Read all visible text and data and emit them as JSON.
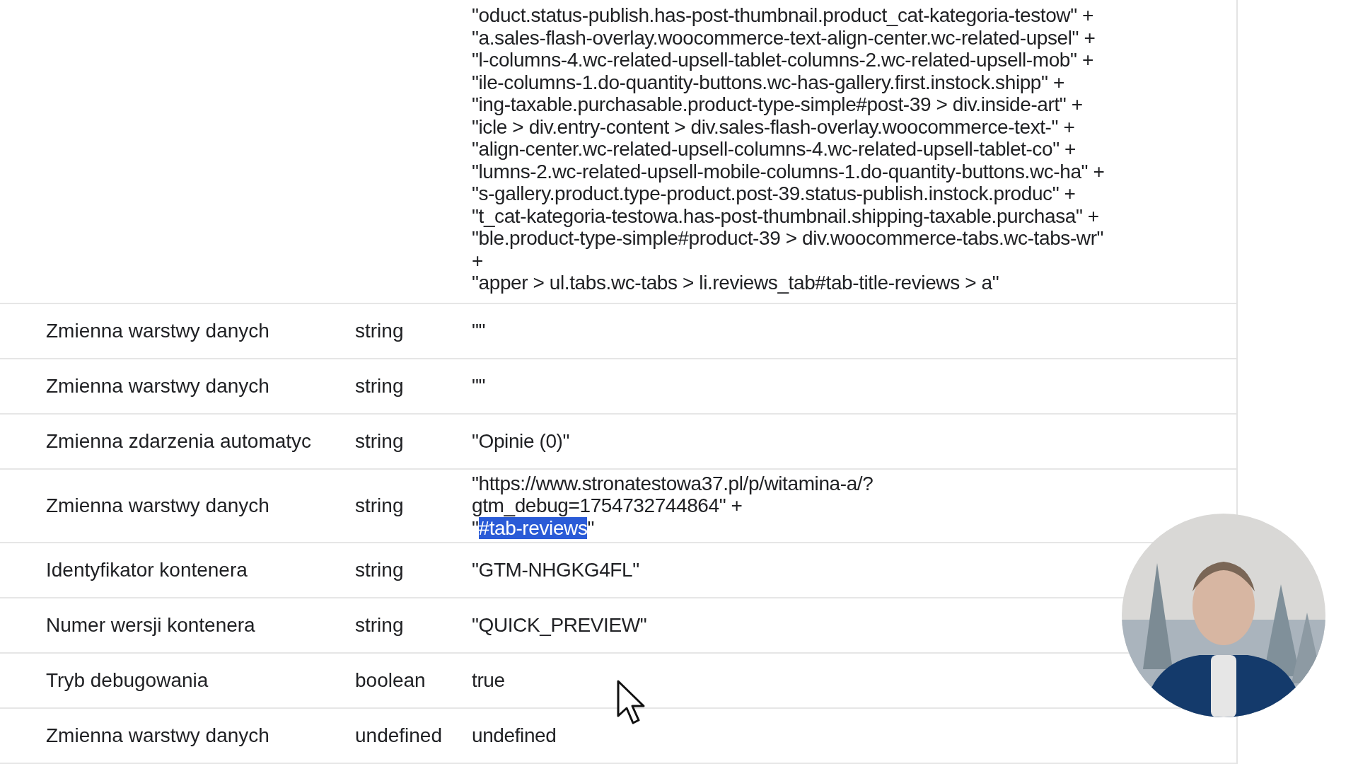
{
  "table": {
    "rows": [
      {
        "value_lines": [
          "\"oduct.status-publish.has-post-thumbnail.product_cat-kategoria-testow\" +",
          "\"a.sales-flash-overlay.woocommerce-text-align-center.wc-related-upsel\" +",
          "\"l-columns-4.wc-related-upsell-tablet-columns-2.wc-related-upsell-mob\" +",
          "\"ile-columns-1.do-quantity-buttons.wc-has-gallery.first.instock.shipp\" +",
          "\"ing-taxable.purchasable.product-type-simple#post-39 > div.inside-art\" +",
          "\"icle > div.entry-content > div.sales-flash-overlay.woocommerce-text-\" +",
          "\"align-center.wc-related-upsell-columns-4.wc-related-upsell-tablet-co\" +",
          "\"lumns-2.wc-related-upsell-mobile-columns-1.do-quantity-buttons.wc-ha\" +",
          "\"s-gallery.product.type-product.post-39.status-publish.instock.produc\" +",
          "\"t_cat-kategoria-testowa.has-post-thumbnail.shipping-taxable.purchasa\" +",
          "\"ble.product-type-simple#product-39 > div.woocommerce-tabs.wc-tabs-wr\"",
          "+",
          "\"apper > ul.tabs.wc-tabs > li.reviews_tab#tab-title-reviews > a\""
        ]
      },
      {
        "name": "Zmienna warstwy danych",
        "type": "string",
        "value_lines": [
          "\"\""
        ]
      },
      {
        "name": "Zmienna warstwy danych",
        "type": "string",
        "value_lines": [
          "\"\""
        ]
      },
      {
        "name": "Zmienna zdarzenia automatyc",
        "type": "string",
        "value_lines": [
          "\"Opinie (0)\""
        ]
      },
      {
        "name": "Zmienna warstwy danych",
        "type": "string",
        "value_lines": [
          "\"https://www.stronatestowa37.pl/p/witamina-a/?",
          "gtm_debug=1754732744864\" +",
          [
            {
              "text": "\"",
              "selected": false
            },
            {
              "text": "#tab-reviews",
              "selected": true
            },
            {
              "text": "\"",
              "selected": false
            }
          ]
        ]
      },
      {
        "name": "Identyfikator kontenera",
        "type": "string",
        "value_lines": [
          "\"GTM-NHGKG4FL\""
        ]
      },
      {
        "name": "Numer wersji kontenera",
        "type": "string",
        "value_lines": [
          "\"QUICK_PREVIEW\""
        ]
      },
      {
        "name": "Tryb debugowania",
        "type": "boolean",
        "value_lines": [
          "true"
        ]
      },
      {
        "name": "Zmienna warstwy danych",
        "type": "undefined",
        "value_lines": [
          "undefined"
        ]
      }
    ]
  }
}
